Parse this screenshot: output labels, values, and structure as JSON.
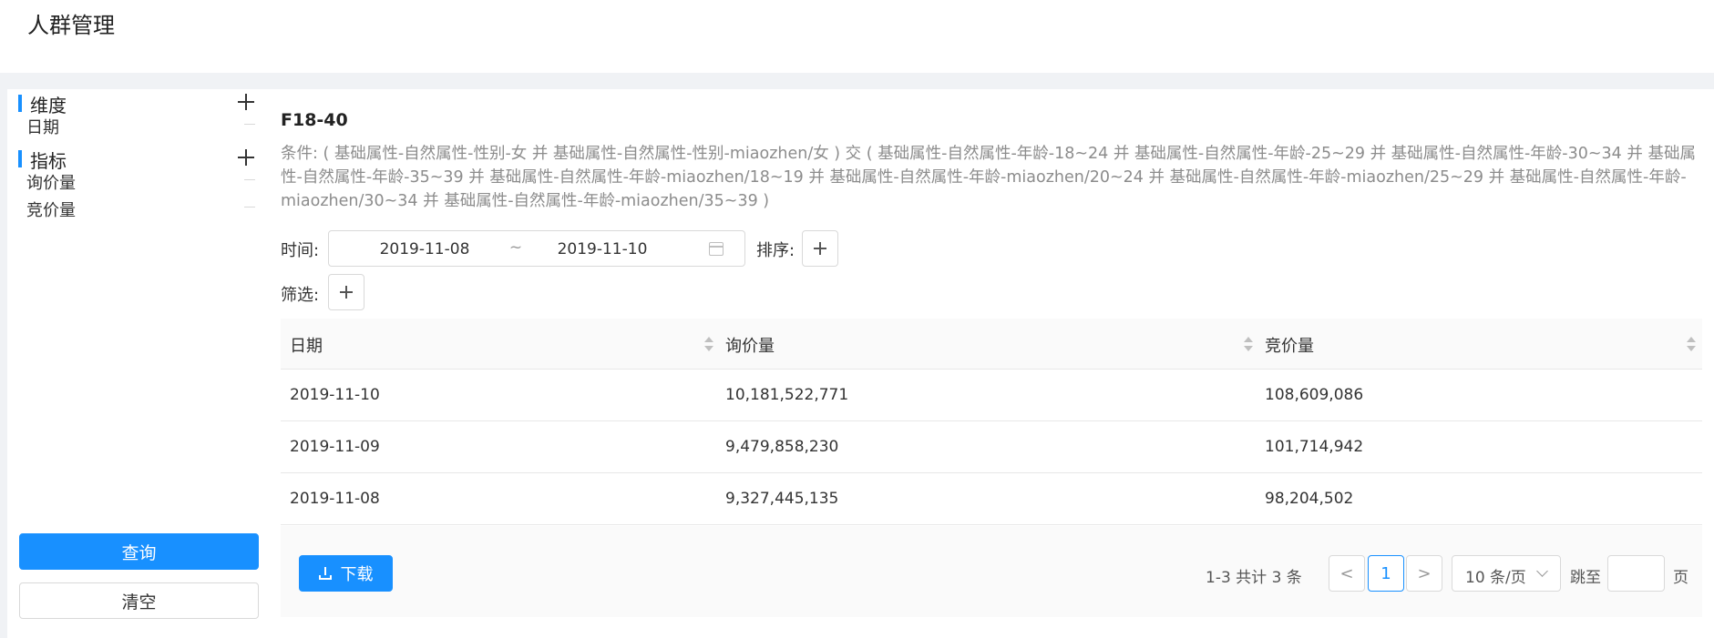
{
  "page": {
    "title": "人群管理"
  },
  "sidebar": {
    "dimension": {
      "title": "维度",
      "items": [
        "日期"
      ]
    },
    "metric": {
      "title": "指标",
      "items": [
        "询价量",
        "竞价量"
      ]
    },
    "query_label": "查询",
    "clear_label": "清空"
  },
  "main": {
    "cohort_name": "F18-40",
    "conditions": "条件: ( 基础属性-自然属性-性别-女 并 基础属性-自然属性-性别-miaozhen/女 ) 交 ( 基础属性-自然属性-年龄-18~24 并 基础属性-自然属性-年龄-25~29 并 基础属性-自然属性-年龄-30~34 并 基础属性-自然属性-年龄-35~39 并 基础属性-自然属性-年龄-miaozhen/18~19 并 基础属性-自然属性-年龄-miaozhen/20~24 并 基础属性-自然属性-年龄-miaozhen/25~29 并 基础属性-自然属性-年龄-miaozhen/30~34 并 基础属性-自然属性-年龄-miaozhen/35~39 )",
    "time_label": "时间:",
    "date_start": "2019-11-08",
    "date_sep": "~",
    "date_end": "2019-11-10",
    "sort_label": "排序:",
    "filter_label": "筛选:"
  },
  "table": {
    "columns": [
      "日期",
      "询价量",
      "竞价量"
    ],
    "rows": [
      [
        "2019-11-10",
        "10,181,522,771",
        "108,609,086"
      ],
      [
        "2019-11-09",
        "9,479,858,230",
        "101,714,942"
      ],
      [
        "2019-11-08",
        "9,327,445,135",
        "98,204,502"
      ]
    ]
  },
  "footer": {
    "download_label": "下载",
    "total": "1-3 共计 3 条",
    "prev": "<",
    "current_page": "1",
    "next": ">",
    "page_size": "10 条/页",
    "jump_label": "跳至",
    "page_unit": "页"
  },
  "colors": {
    "primary": "#1890ff",
    "muted_text": "#8c8c8c"
  },
  "icons": {
    "add": "plus-icon",
    "calendar": "calendar-icon",
    "sort": "sort-icon",
    "download": "download-icon",
    "chevron": "chevron-down-icon"
  }
}
